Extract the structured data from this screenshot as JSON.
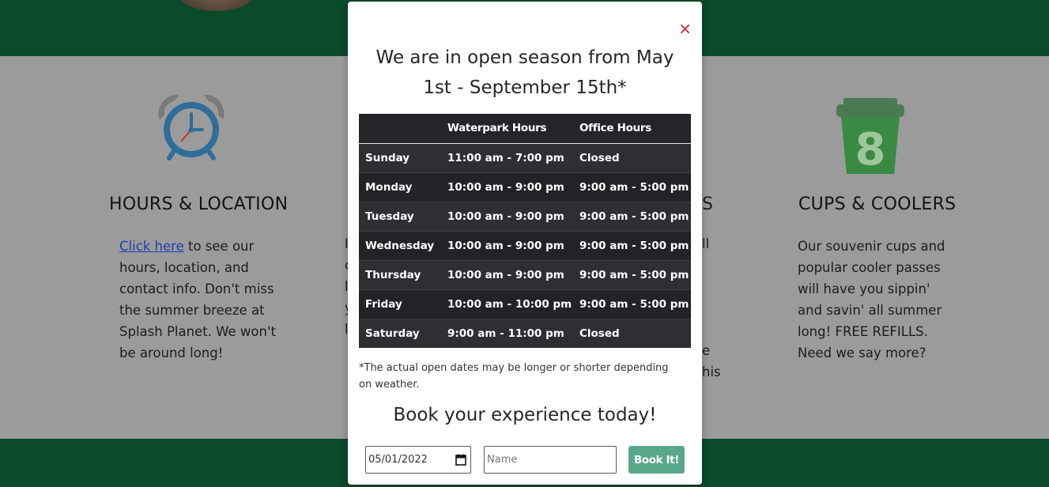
{
  "features": {
    "hours": {
      "title": "HOURS & LOCATION",
      "link_text": "Click here",
      "body": " to see our hours, location, and contact info. Don't miss the summer breeze at Splash Planet. We won't be around long!"
    },
    "cups": {
      "title": "CUPS & COOLERS",
      "body": "Our souvenir cups and popular cooler passes will have you sippin' and savin' all summer long! FREE REFILLS. Need we say more?"
    },
    "partial": {
      "left_letters": [
        "I",
        "c",
        "l",
        "y",
        "l"
      ],
      "right_heading": "S",
      "right_letters": [
        "ll",
        "e",
        "his"
      ]
    }
  },
  "icons": {
    "clock": "alarm-clock-icon",
    "cup": "cup-icon",
    "close": "close-icon",
    "calendar": "calendar-icon"
  },
  "modal": {
    "title": "We are in open season from May 1st - September 15th*",
    "close_symbol": "×",
    "table": {
      "headers": [
        "",
        "Waterpark Hours",
        "Office Hours"
      ],
      "rows": [
        [
          "Sunday",
          "11:00 am - 7:00 pm",
          "Closed"
        ],
        [
          "Monday",
          "10:00 am - 9:00 pm",
          "9:00 am - 5:00 pm"
        ],
        [
          "Tuesday",
          "10:00 am - 9:00 pm",
          "9:00 am - 5:00 pm"
        ],
        [
          "Wednesday",
          "10:00 am - 9:00 pm",
          "9:00 am - 5:00 pm"
        ],
        [
          "Thursday",
          "10:00 am - 9:00 pm",
          "9:00 am - 5:00 pm"
        ],
        [
          "Friday",
          "10:00 am - 10:00 pm",
          "9:00 am - 5:00 pm"
        ],
        [
          "Saturday",
          "9:00 am - 11:00 pm",
          "Closed"
        ]
      ]
    },
    "note": "*The actual open dates may be longer or shorter depending on weather.",
    "book_title": "Book your experience today!",
    "date_value": "05/01/2022",
    "name_placeholder": "Name",
    "book_button": "Book It!"
  },
  "colors": {
    "brand_green": "#0b4a2b",
    "button_green": "#5aa88a",
    "close_red": "#c4203b",
    "clock_blue": "#2f6d9a",
    "cup_green": "#3a8a44"
  }
}
